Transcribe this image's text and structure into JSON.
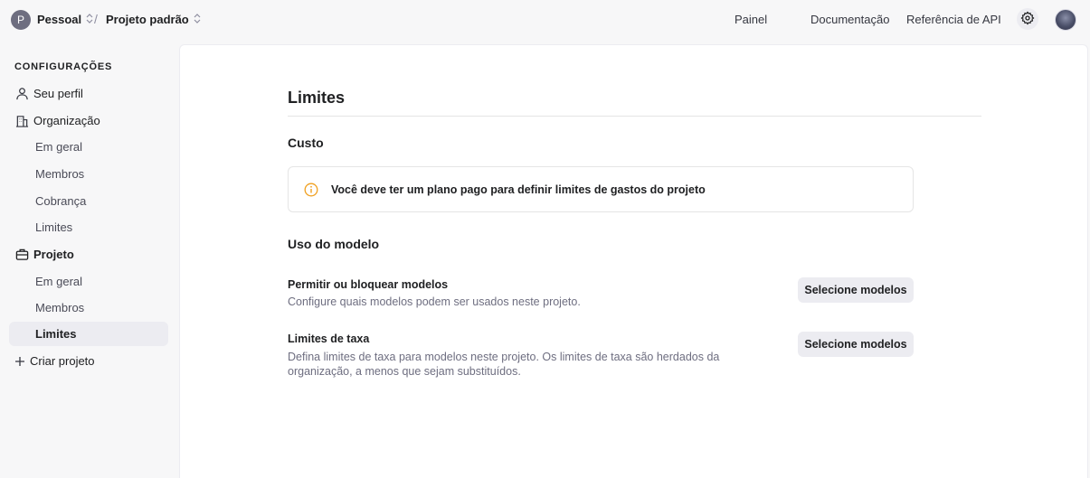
{
  "topbar": {
    "org_initial": "P",
    "org_name": "Pessoal",
    "separator": "/",
    "project_name": "Projeto padrão",
    "nav": [
      "Painel",
      "Documentação",
      "Referência de API"
    ]
  },
  "sidebar": {
    "heading": "CONFIGURAÇÕES",
    "profile": "Seu perfil",
    "organization": "Organização",
    "org_items": [
      "Em geral",
      "Membros",
      "Cobrança",
      "Limites"
    ],
    "project": "Projeto",
    "project_items": [
      "Em geral",
      "Membros",
      "Limites"
    ],
    "create_project": "Criar projeto",
    "active_item": "Limites"
  },
  "main": {
    "title": "Limites",
    "cost_section": "Custo",
    "cost_notice": "Você deve ter um plano pago para definir limites de gastos do projeto",
    "model_usage_section": "Uso do modelo",
    "rows": [
      {
        "title": "Permitir ou bloquear modelos",
        "description": "Configure quais modelos podem ser usados neste projeto.",
        "button": "Selecione modelos"
      },
      {
        "title": "Limites de taxa",
        "description": "Defina limites de taxa para modelos neste projeto. Os limites de taxa são herdados da organização, a menos que sejam substituídos.",
        "button": "Selecione modelos"
      }
    ]
  },
  "colors": {
    "accent_warning": "#f0a020",
    "active_bg": "#ececf1",
    "sidebar_bg": "#f7f7f8"
  }
}
